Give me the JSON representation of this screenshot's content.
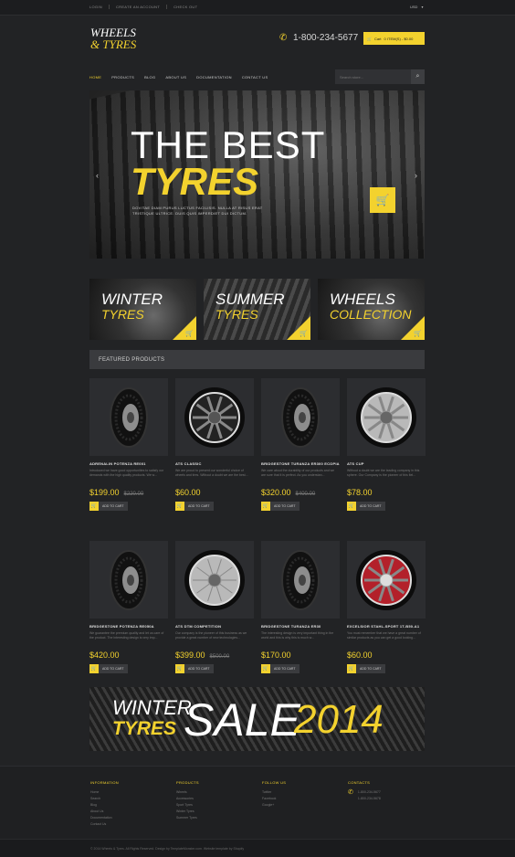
{
  "topbar": {
    "links": [
      "LOGIN",
      "CREATE AN ACCOUNT",
      "CHECK OUT"
    ],
    "currency": "USD"
  },
  "header": {
    "logo_line1": "WHEELS",
    "logo_line2": "& TYRES",
    "phone": "1-800-234-5677",
    "cart_label": "Cart",
    "cart_summary": "0 ITEM(S) - $0.00"
  },
  "nav": {
    "items": [
      "HOME",
      "PRODUCTS",
      "BLOG",
      "ABOUT US",
      "DOCUMENTATION",
      "CONTACT US"
    ],
    "search_placeholder": "Search store..."
  },
  "slider": {
    "line1": "THE BEST",
    "line2": "TYRES",
    "text": "DOVITAE DIAM PURUS LUCTUS FACILISIS. NULLA AT RISUS ERAT TRISTIQUE ULTRICE. DUIS QUIS IMPERDIET DUI DICTUM."
  },
  "banners": [
    {
      "w1": "WINTER",
      "w2": "TYRES"
    },
    {
      "w1": "SUMMER",
      "w2": "TYRES"
    },
    {
      "w1": "WHEELS",
      "w2": "COLLECTION"
    }
  ],
  "featured": {
    "title": "FEATURED PRODUCTS",
    "add_label": "ADD TO CART",
    "products": [
      {
        "name": "ADRENALIN POTENZA RE001",
        "desc": "Introduced we have good opportunities to satisfy our demands with the high quality products. We w...",
        "price": "$199.00",
        "old": "$220.00",
        "img": "tyre"
      },
      {
        "name": "ATS CLASSIC",
        "desc": "We are proud to present our wonderful choice of wheels and tires. Without a doubt we are the best...",
        "price": "$60.00",
        "old": "",
        "img": "wheel-dark"
      },
      {
        "name": "BRIDGESTONE TURANZA ER300 ECOPIA",
        "desc": "We care about the durability of our products and we are sure that it is perfect. As you understan...",
        "price": "$320.00",
        "old": "$400.00",
        "img": "tyre"
      },
      {
        "name": "ATS CUP",
        "desc": "Without a doubt we are the leading company in this sphere. Our Company is the pioneer of this fiel...",
        "price": "$78.00",
        "old": "",
        "img": "wheel-silver"
      },
      {
        "name": "BRIDGESTONE POTENZA RE050A",
        "desc": "We guarantee the premium quality and let us care of the product. The interesting design is very imp...",
        "price": "$420.00",
        "old": "",
        "img": "tyre"
      },
      {
        "name": "ATS DTM COMPETITION",
        "desc": "Our company is the pioneer of this business as we provide a great number of new technologies...",
        "price": "$399.00",
        "old": "$500.00",
        "img": "wheel-spoke"
      },
      {
        "name": "BRIDGESTONE TURANZA ER30",
        "desc": "The interesting design is very important thing in the world and this is why this is much w...",
        "price": "$170.00",
        "old": "",
        "img": "tyre"
      },
      {
        "name": "EXCELSIOR STAHL-SPORT 1T-B50-A1",
        "desc": "You must remember that we have a great number of similar products as you can get a good looking...",
        "price": "$60.00",
        "old": "",
        "img": "wheel-red"
      }
    ]
  },
  "sale": {
    "w1": "WINTER",
    "w2": "TYRES",
    "w3": "SALE",
    "w4": "2014"
  },
  "footer": {
    "information": {
      "title": "INFORMATION",
      "items": [
        "Home",
        "Search",
        "Blog",
        "About Us",
        "Documentation",
        "Contact Us"
      ]
    },
    "products": {
      "title": "PRODUCTS",
      "items": [
        "Wheels",
        "Accessories",
        "Sport Tyres",
        "Winter Tyres",
        "Summer Tyres"
      ]
    },
    "follow": {
      "title": "FOLLOW US",
      "items": [
        "Twitter",
        "Facebook",
        "Google+"
      ]
    },
    "contacts": {
      "title": "CONTACTS",
      "phone1": "1-800-234-5677",
      "phone2": "1-800-234-5678"
    },
    "copyright": "© 2014 Wheels & Tyres. All Rights Reserved. Design by TemplateMonster.com. Website template by Shopify"
  },
  "colors": {
    "accent": "#f3d22e",
    "background": "#222325"
  }
}
